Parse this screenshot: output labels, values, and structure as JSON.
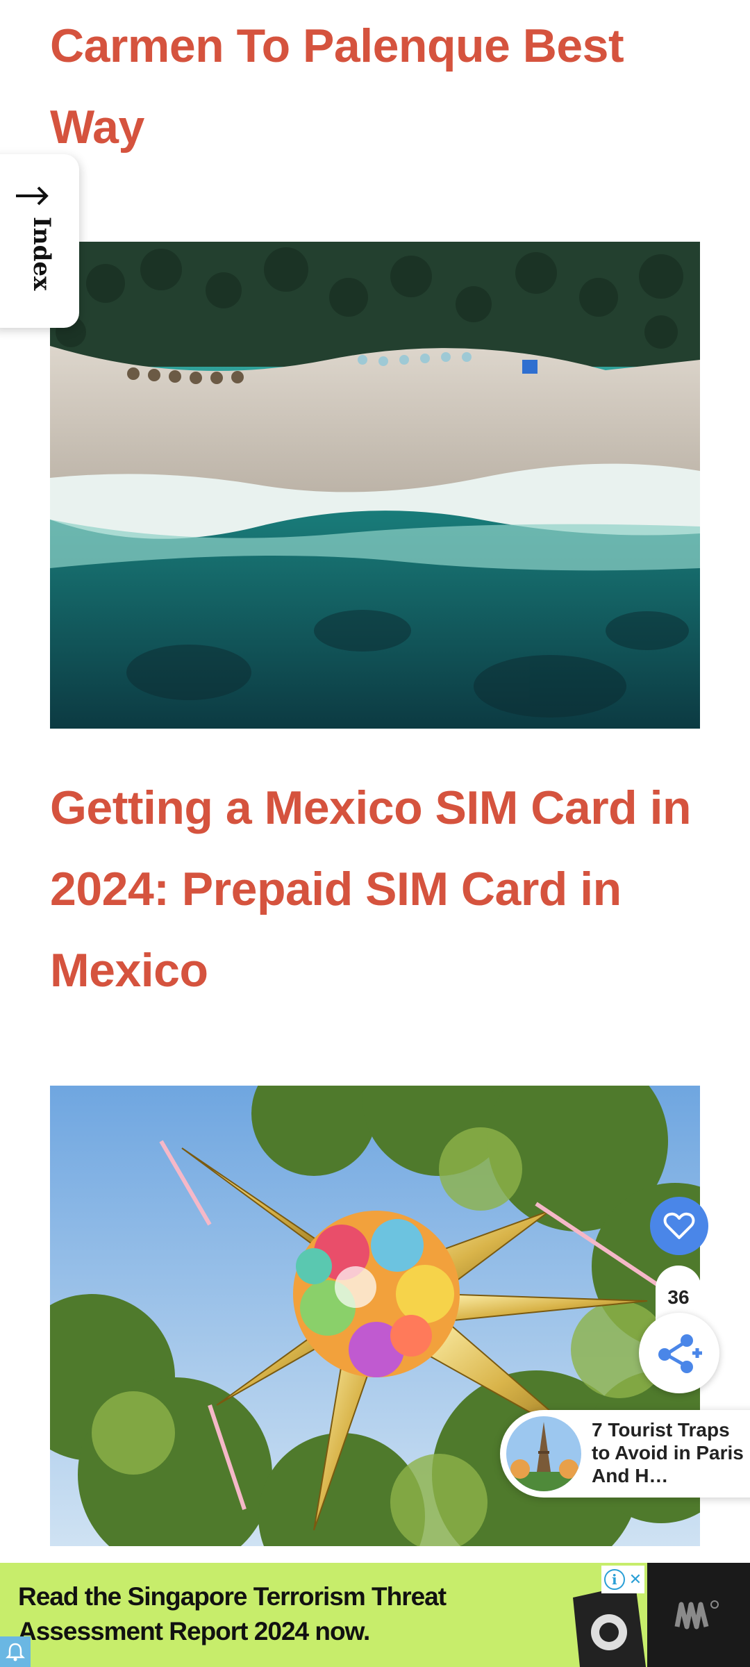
{
  "posts": [
    {
      "title": "Carmen To Palenque Best Way",
      "image": "beach-aerial"
    },
    {
      "title": "Getting a Mexico SIM Card in 2024: Prepaid SIM Card in Mexico",
      "image": "pinata"
    }
  ],
  "index_tab": {
    "label": "Index",
    "arrow": "⟶"
  },
  "floating": {
    "like_count": "36"
  },
  "recommendation": {
    "title": "7 Tourist Traps to Avoid in Paris And H…"
  },
  "ad": {
    "text": "Read the Singapore Terrorism Threat Assessment Report 2024 now.",
    "info_icon": "i",
    "close_icon": "✕"
  },
  "colors": {
    "title": "#d5533e",
    "heart_button": "#4a86e8",
    "ad_background": "#c7ed6b"
  },
  "icons": [
    "arrow-up-icon",
    "heart-icon",
    "share-icon",
    "info-icon",
    "close-icon",
    "brand-logo-icon",
    "notification-icon"
  ]
}
